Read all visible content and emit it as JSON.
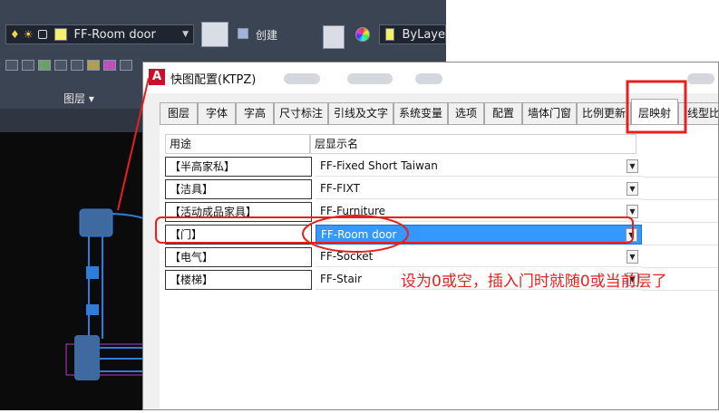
{
  "ribbon": {
    "layer_combo": "FF-Room door",
    "create_label": "创建",
    "bylayer_label": "ByLaye",
    "panel_label": "图层 ▾"
  },
  "dialog": {
    "title": "快图配置(KTPZ)",
    "tabs": [
      "图层",
      "字体",
      "字高",
      "尺寸标注",
      "引线及文字",
      "系统变量",
      "选项",
      "配置",
      "墙体门窗",
      "比例更新",
      "层映射",
      "线型比例"
    ],
    "active_tab": "层映射",
    "columns": [
      "用途",
      "层显示名"
    ],
    "rows": [
      {
        "use": "【半高家私】",
        "layer": "FF-Fixed Short Taiwan"
      },
      {
        "use": "【洁具】",
        "layer": "FF-FIXT"
      },
      {
        "use": "【活动成品家具】",
        "layer": "FF-Furniture"
      },
      {
        "use": "【门】",
        "layer": "FF-Room door",
        "selected": true
      },
      {
        "use": "【电气】",
        "layer": "FF-Socket"
      },
      {
        "use": "【楼梯】",
        "layer": "FF-Stair"
      }
    ]
  },
  "annotation": {
    "note": "设为0或空，插入门时就随0或当前层了",
    "color": "#e62020"
  },
  "colors": {
    "selection": "#3399ff",
    "cad_bg": "#0b0b0b",
    "ribbon_bg": "#3b4453",
    "entity_blue": "#2f7dd8"
  }
}
